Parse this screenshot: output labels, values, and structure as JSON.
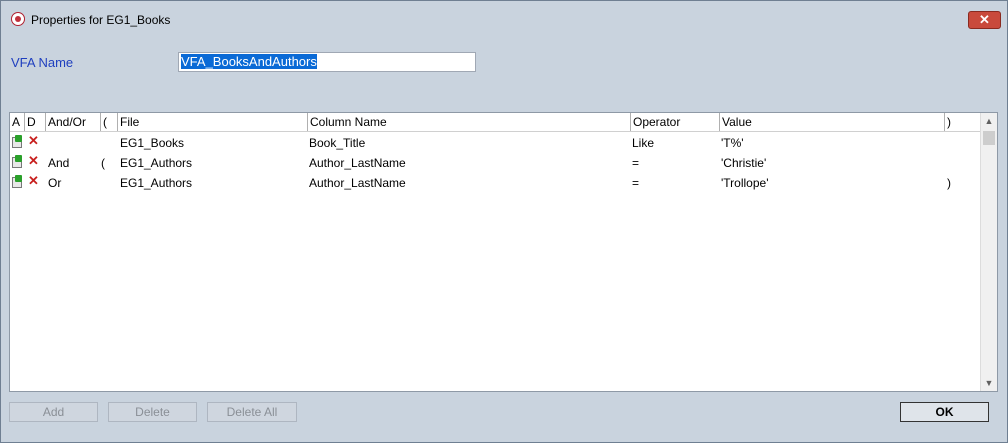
{
  "window": {
    "title": "Properties for EG1_Books",
    "close_label": "✕"
  },
  "form": {
    "vfa_name_label": "VFA Name",
    "vfa_name_value": "VFA_BooksAndAuthors"
  },
  "grid": {
    "columns": [
      "A",
      "D",
      "And/Or",
      "(",
      "File",
      "Column Name",
      "Operator",
      "Value",
      ")"
    ],
    "rows": [
      {
        "andor": "",
        "open_paren": "",
        "file": "EG1_Books",
        "column": "Book_Title",
        "operator": "Like",
        "value": "'T%'",
        "close_paren": ""
      },
      {
        "andor": "And",
        "open_paren": "(",
        "file": "EG1_Authors",
        "column": "Author_LastName",
        "operator": "=",
        "value": "'Christie'",
        "close_paren": ""
      },
      {
        "andor": "Or",
        "open_paren": "",
        "file": "EG1_Authors",
        "column": "Author_LastName",
        "operator": "=",
        "value": "'Trollope'",
        "close_paren": ")"
      }
    ]
  },
  "buttons": {
    "add": "Add",
    "delete": "Delete",
    "delete_all": "Delete All",
    "ok": "OK"
  },
  "icons": {
    "app": "app-icon",
    "add_row": "add-row-icon",
    "delete_row": "delete-row-icon"
  },
  "colors": {
    "label_blue": "#1f3fbf",
    "selection": "#0a6ad6",
    "close": "#c94a3c"
  }
}
